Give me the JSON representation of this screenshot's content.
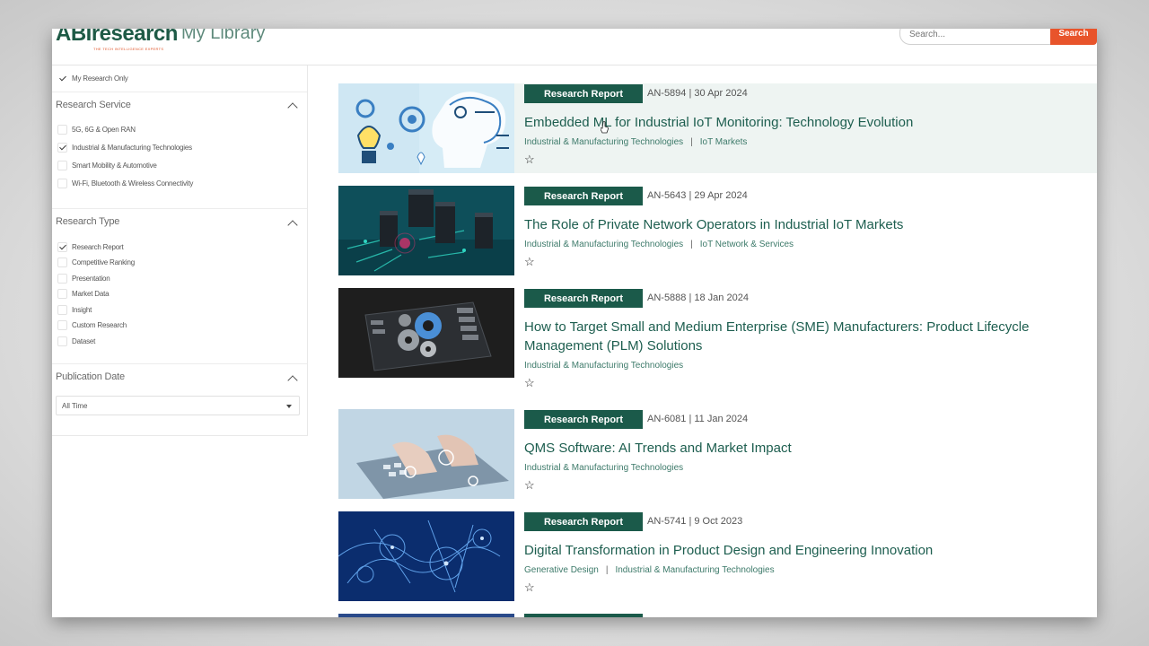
{
  "header": {
    "logo_text": "ABIresearch",
    "logo_tagline": "THE TECH INTELLIGENCE EXPERTS",
    "page_title": "My Library",
    "search_placeholder": "Search...",
    "search_button": "Search"
  },
  "sidebar": {
    "my_research_only": "My Research Only",
    "research_service": {
      "title": "Research Service",
      "items": [
        {
          "label": "5G, 6G & Open RAN",
          "checked": false
        },
        {
          "label": "Industrial & Manufacturing Technologies",
          "checked": true
        },
        {
          "label": "Smart Mobility & Automotive",
          "checked": false
        },
        {
          "label": "Wi-Fi, Bluetooth & Wireless Connectivity",
          "checked": false
        }
      ]
    },
    "research_type": {
      "title": "Research Type",
      "items": [
        {
          "label": "Research Report",
          "checked": true
        },
        {
          "label": "Competitive Ranking",
          "checked": false
        },
        {
          "label": "Presentation",
          "checked": false
        },
        {
          "label": "Market Data",
          "checked": false
        },
        {
          "label": "Insight",
          "checked": false
        },
        {
          "label": "Custom Research",
          "checked": false
        },
        {
          "label": "Dataset",
          "checked": false
        }
      ]
    },
    "publication_date": {
      "title": "Publication Date",
      "selected": "All Time"
    }
  },
  "results": [
    {
      "badge": "Research Report",
      "meta": "AN-5894 | 30 Apr 2024",
      "title": "Embedded ML for Industrial IoT Monitoring: Technology Evolution",
      "tags": [
        "Industrial & Manufacturing Technologies",
        "IoT Markets"
      ],
      "star": "☆"
    },
    {
      "badge": "Research Report",
      "meta": "AN-5643 | 29 Apr 2024",
      "title": "The Role of Private Network Operators in Industrial IoT Markets",
      "tags": [
        "Industrial & Manufacturing Technologies",
        "IoT Network & Services"
      ],
      "star": "☆"
    },
    {
      "badge": "Research Report",
      "meta": "AN-5888 | 18 Jan 2024",
      "title": "How to Target Small and Medium Enterprise (SME) Manufacturers: Product Lifecycle Management (PLM) Solutions",
      "tags": [
        "Industrial & Manufacturing Technologies"
      ],
      "star": "☆"
    },
    {
      "badge": "Research Report",
      "meta": "AN-6081 | 11 Jan 2024",
      "title": "QMS Software: AI Trends and Market Impact",
      "tags": [
        "Industrial & Manufacturing Technologies"
      ],
      "star": "☆"
    },
    {
      "badge": "Research Report",
      "meta": "AN-5741 | 9 Oct 2023",
      "title": "Digital Transformation in Product Design and Engineering Innovation",
      "tags": [
        "Generative Design",
        "Industrial & Manufacturing Technologies"
      ],
      "star": "☆"
    }
  ],
  "colors": {
    "brand_green": "#1b5a4a",
    "accent_orange": "#e8542b",
    "highlight_row": "#eef4f2"
  }
}
